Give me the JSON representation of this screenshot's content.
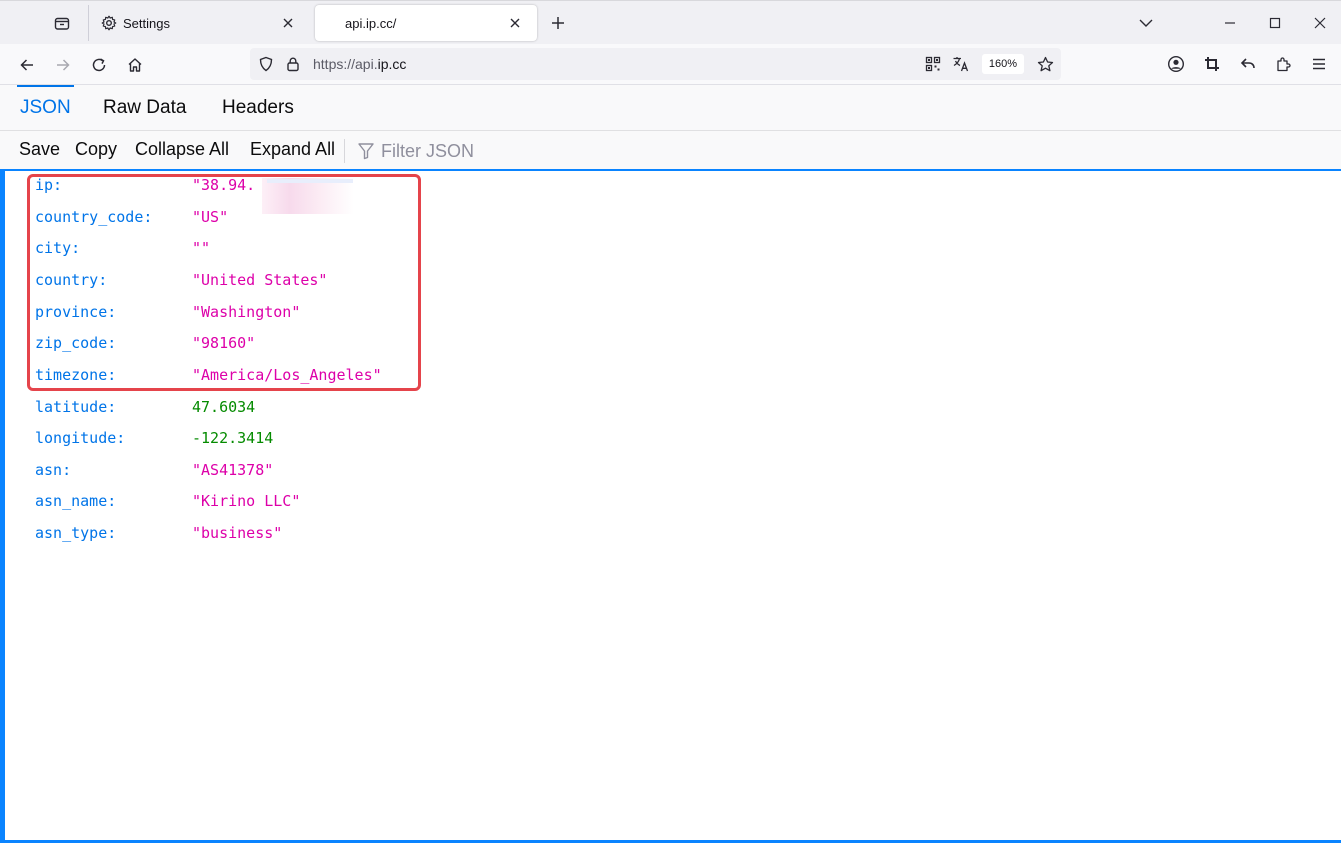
{
  "browser": {
    "tabs": [
      {
        "title": "Settings",
        "icon": "gear-icon",
        "active": false
      },
      {
        "title": "api.ip.cc/",
        "icon": "",
        "active": true
      }
    ],
    "url": {
      "prefix": "https://api.",
      "domain": "ip.cc"
    },
    "zoom": "160%",
    "accent": "#0a84ff"
  },
  "viewer": {
    "tabs": [
      "JSON",
      "Raw Data",
      "Headers"
    ],
    "toolbar": {
      "save": "Save",
      "copy": "Copy",
      "collapse_all": "Collapse All",
      "expand_all": "Expand All",
      "filter_placeholder": "Filter JSON"
    },
    "rows": [
      {
        "key": "ip:",
        "value": "\"38.94.",
        "type": "string"
      },
      {
        "key": "country_code:",
        "value": "\"US\"",
        "type": "string"
      },
      {
        "key": "city:",
        "value": "\"\"",
        "type": "string"
      },
      {
        "key": "country:",
        "value": "\"United States\"",
        "type": "string"
      },
      {
        "key": "province:",
        "value": "\"Washington\"",
        "type": "string"
      },
      {
        "key": "zip_code:",
        "value": "\"98160\"",
        "type": "string"
      },
      {
        "key": "timezone:",
        "value": "\"America/Los_Angeles\"",
        "type": "string"
      },
      {
        "key": "latitude:",
        "value": "47.6034",
        "type": "number"
      },
      {
        "key": "longitude:",
        "value": "-122.3414",
        "type": "number"
      },
      {
        "key": "asn:",
        "value": "\"AS41378\"",
        "type": "string"
      },
      {
        "key": "asn_name:",
        "value": "\"Kirino LLC\"",
        "type": "string"
      },
      {
        "key": "asn_type:",
        "value": "\"business\"",
        "type": "string"
      }
    ],
    "colors": {
      "key": "#0074e8",
      "string": "#dd00a9",
      "number": "#058b00",
      "highlight": "#e5444b"
    }
  }
}
